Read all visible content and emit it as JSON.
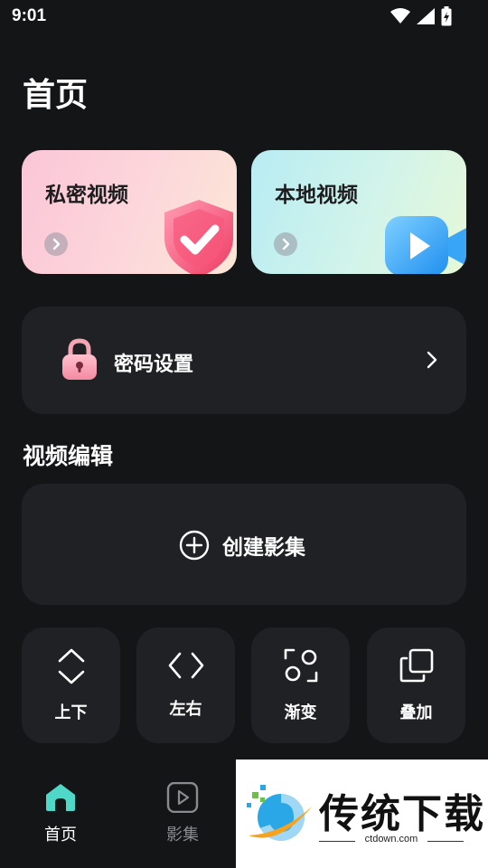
{
  "status_bar": {
    "time": "9:01"
  },
  "page": {
    "title": "首页"
  },
  "cards": [
    {
      "label": "私密视频",
      "art": "shield-check-icon"
    },
    {
      "label": "本地视频",
      "art": "video-camera-icon"
    }
  ],
  "password": {
    "label": "密码设置"
  },
  "video_edit": {
    "title": "视频编辑",
    "create_label": "创建影集",
    "tools": [
      {
        "label": "上下",
        "icon": "up-down-icon"
      },
      {
        "label": "左右",
        "icon": "left-right-icon"
      },
      {
        "label": "渐变",
        "icon": "gradient-icon"
      },
      {
        "label": "叠加",
        "icon": "overlay-icon"
      }
    ]
  },
  "bottom_nav": {
    "items": [
      {
        "label": "首页",
        "active": true
      },
      {
        "label": "影集",
        "active": false
      }
    ]
  },
  "watermark": {
    "text": "传统下载",
    "url": "ctdown.com"
  },
  "colors": {
    "background": "#141517",
    "card": "#202124",
    "accent": "#4fd8c8"
  }
}
